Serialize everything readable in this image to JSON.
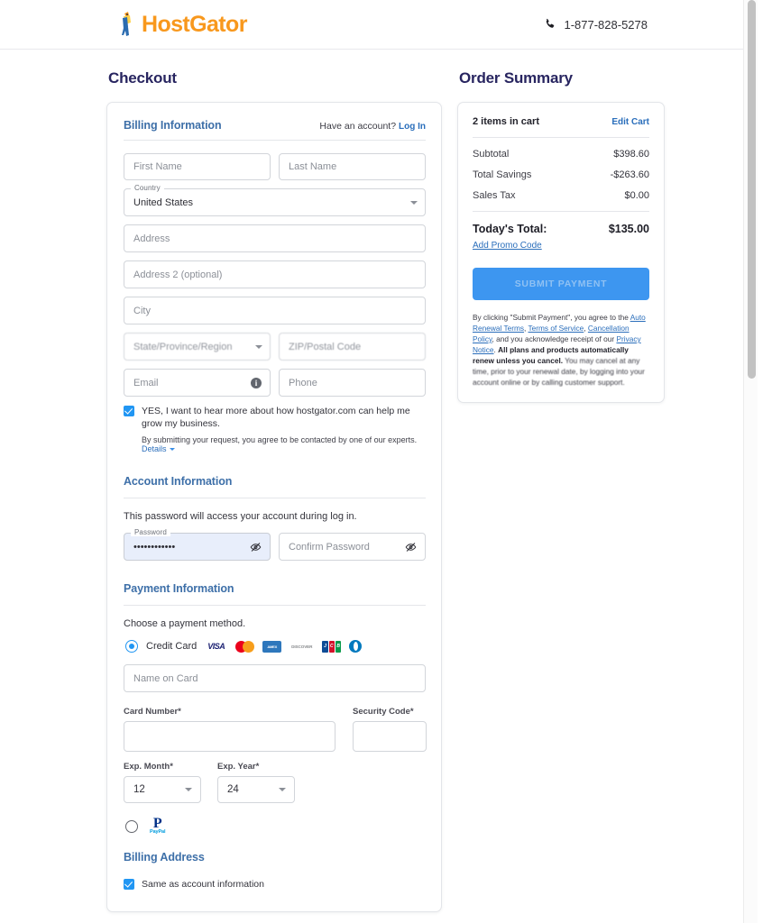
{
  "header": {
    "brand_name": "HostGator",
    "brand_color": "#f8981d",
    "phone": "1-877-828-5278",
    "phone_icon": "phone-icon"
  },
  "checkout": {
    "title": "Checkout",
    "billing": {
      "section_title": "Billing Information",
      "account_question": "Have an account?",
      "login_label": "Log In",
      "first_name_placeholder": "First Name",
      "last_name_placeholder": "Last Name",
      "country_label": "Country",
      "country_value": "United States",
      "address_placeholder": "Address",
      "address2_placeholder": "Address 2 (optional)",
      "city_placeholder": "City",
      "state_placeholder": "State/Province/Region",
      "zip_placeholder": "ZIP/Postal Code",
      "email_placeholder": "Email",
      "phone_placeholder": "Phone",
      "consent_text": "YES, I want to hear more about how hostgator.com can help me grow my business.",
      "consent_sub": "By submitting your request, you agree to be contacted by one of our experts.",
      "details_label": "Details"
    },
    "account": {
      "section_title": "Account Information",
      "description": "This password will access your account during log in.",
      "password_label": "Password",
      "password_value": "••••••••••••",
      "confirm_placeholder": "Confirm Password"
    },
    "payment": {
      "section_title": "Payment Information",
      "choose_method": "Choose a payment method.",
      "credit_card_label": "Credit Card",
      "card_brands": [
        "VISA",
        "Mastercard",
        "American Express",
        "Discover",
        "JCB",
        "Diners Club"
      ],
      "name_on_card_placeholder": "Name on Card",
      "card_number_label": "Card Number*",
      "security_code_label": "Security Code*",
      "exp_month_label": "Exp. Month*",
      "exp_month_value": "12",
      "exp_year_label": "Exp. Year*",
      "exp_year_value": "24",
      "paypal_label": "PayPal",
      "paypal_word": "PayPal"
    },
    "billing_address": {
      "section_title": "Billing Address",
      "same_as_account_label": "Same as account information"
    }
  },
  "order_summary": {
    "title": "Order Summary",
    "items_in_cart": "2 items in cart",
    "edit_cart_label": "Edit Cart",
    "lines": [
      {
        "label": "Subtotal",
        "value": "$398.60"
      },
      {
        "label": "Total Savings",
        "value": "-$263.60"
      },
      {
        "label": "Sales Tax",
        "value": "$0.00"
      }
    ],
    "total_label": "Today's Total:",
    "total_value": "$135.00",
    "promo_label": "Add Promo Code",
    "submit_label": "SUBMIT PAYMENT",
    "submit_color": "#3d96f0",
    "legal": {
      "p1": "By clicking \"Submit Payment\", you agree to the ",
      "link1": "Auto Renewal Terms",
      "sep1": ", ",
      "link2": "Terms of Service",
      "sep2": ", ",
      "link3": "Cancellation Policy",
      "p2": ", and you acknowledge receipt of our ",
      "link4": "Privacy Notice",
      "p3": ". ",
      "bold1": "All plans and products automatically renew unless you cancel.",
      "p4": " You may cancel at any time, prior to your renewal date, by logging into your account online or by calling customer support."
    }
  }
}
